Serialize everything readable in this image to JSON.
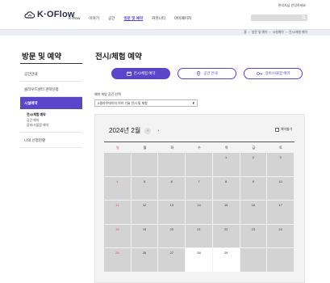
{
  "header": {
    "logo_text": "K·OFlow",
    "util_text": "관리자님 안녕하세요",
    "gnb": [
      "K-Flow",
      "이야기",
      "공간",
      "방문 및 예약",
      "커뮤니티",
      "마이페이지"
    ],
    "gnb_active_index": 3,
    "search_placeholder": ""
  },
  "breadcrumb": [
    "홈",
    "방문 및 예약",
    "시설예약",
    "전시/체험 예약"
  ],
  "sidebar": {
    "title": "방문 및 예약",
    "items": [
      {
        "label": "공간안내"
      },
      {
        "label": "클라우드센터 견학신청"
      },
      {
        "label": "시설예약",
        "active": true
      },
      {
        "label": "나의 신청현황"
      }
    ],
    "sub_items": [
      {
        "label": "전시/체험 예약",
        "on": true
      },
      {
        "label": "공간 예약",
        "on": false
      },
      {
        "label": "장비/사물함 예약",
        "on": false
      }
    ]
  },
  "main": {
    "title": "전시/체험 예약",
    "tabs": [
      {
        "label": "전시/체험 예약",
        "icon": "calendar-icon",
        "active": true
      },
      {
        "label": "공간 안내",
        "icon": "location-pin-icon",
        "active": false
      },
      {
        "label": "장비/사물함 예약",
        "icon": "key-icon",
        "active": false
      }
    ],
    "space_label": "예약 희망 공간 선택",
    "space_value": "K클라우데이터 허브 기술 전시 및 체험",
    "calendar": {
      "month_label": "2024년 2월",
      "legend": "예약불가",
      "weekdays": [
        "일",
        "월",
        "화",
        "수",
        "목",
        "금",
        "토"
      ],
      "weeks": [
        [
          "",
          "",
          "",
          "",
          "1",
          "2",
          "3"
        ],
        [
          "4",
          "5",
          "6",
          "7",
          "8",
          "9",
          "10"
        ],
        [
          "11",
          "12",
          "13",
          "14",
          "15",
          "16",
          "17"
        ],
        [
          "18",
          "19",
          "20",
          "21",
          "22",
          "23",
          "24"
        ],
        [
          "25",
          "26",
          "27",
          "28",
          "29",
          "",
          ""
        ]
      ],
      "open_days": [
        "28",
        "29"
      ]
    }
  },
  "colors": {
    "accent": "#5b45c9",
    "sunday": "#d9534f",
    "unavailable": "#d3d3d3"
  }
}
